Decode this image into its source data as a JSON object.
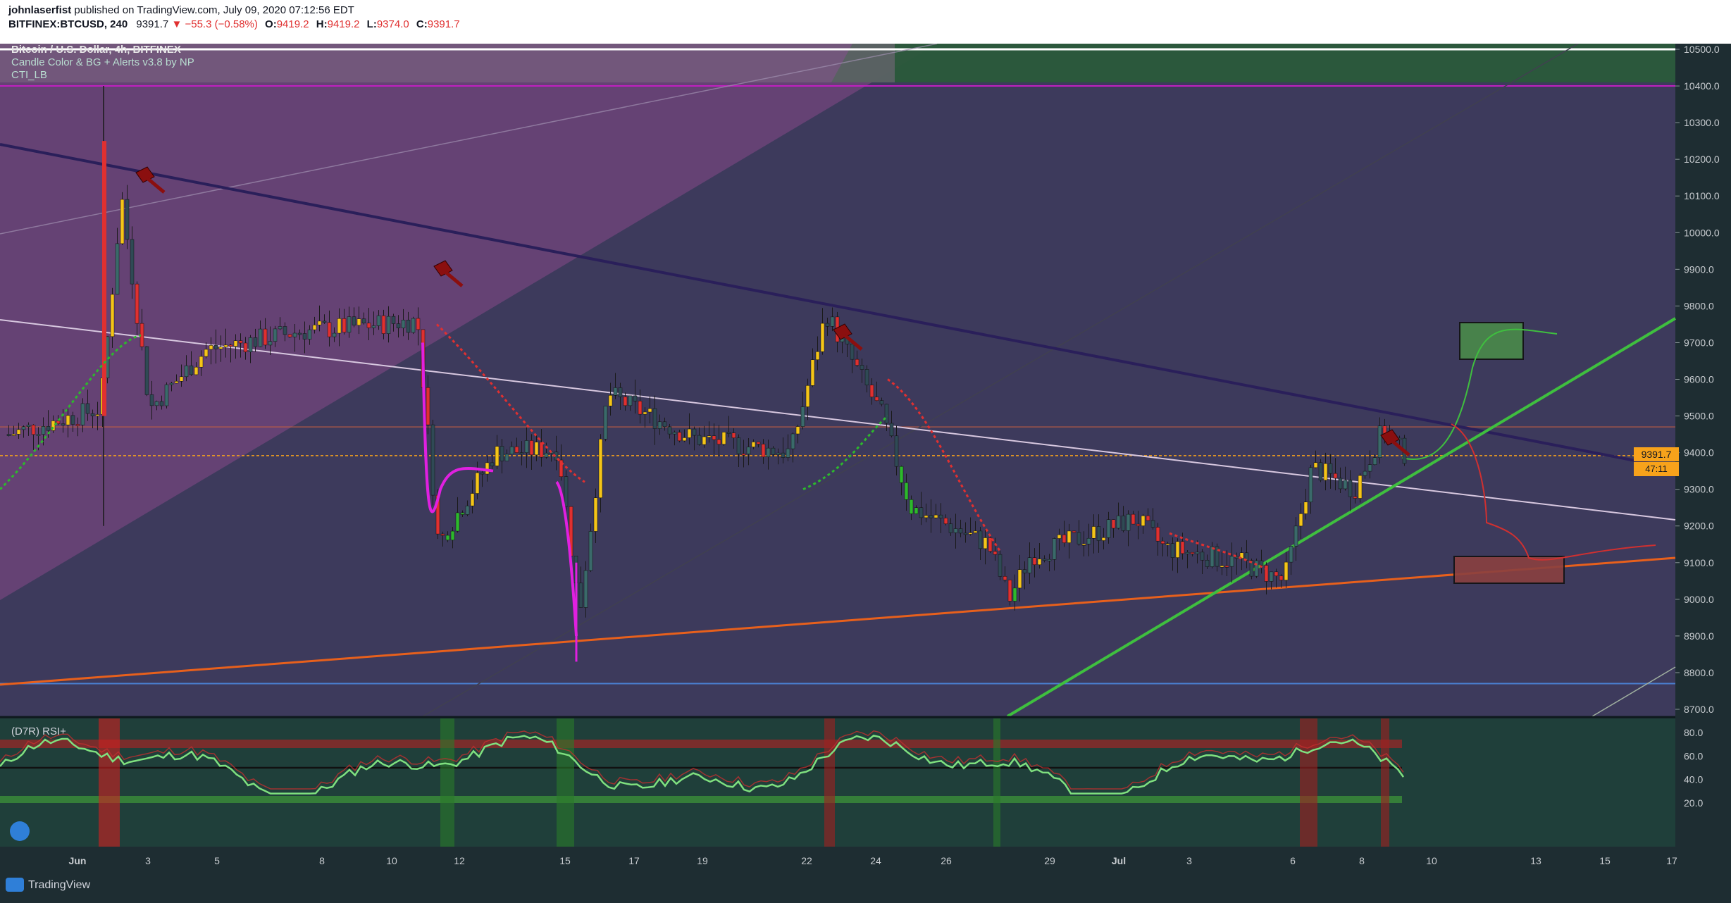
{
  "header": {
    "publisher": "johnlaserfist",
    "published_text": "published on TradingView.com, July 09, 2020 07:12:56 EDT",
    "symbol": "BITFINEX:BTCUSD, 240",
    "last": "9391.7",
    "change": "−55.3 (−0.58%)",
    "o_label": "O:",
    "o_val": "9419.2",
    "h_label": "H:",
    "h_val": "9419.2",
    "l_label": "L:",
    "l_val": "9374.0",
    "c_label": "C:",
    "c_val": "9391.7"
  },
  "legend": {
    "title": "Bitcoin / U.S. Dollar, 4h, BITFINEX",
    "indicator_1": "Candle Color & BG + Alerts v3.8 by NP",
    "indicator_2": "CTI_LB",
    "rsi_label": "(D7R) RSI+"
  },
  "price_axis": {
    "ticks": [
      "10500.0",
      "10400.0",
      "10300.0",
      "10200.0",
      "10100.0",
      "10000.0",
      "9900.0",
      "9800.0",
      "9700.0",
      "9600.0",
      "9500.0",
      "9400.0",
      "9300.0",
      "9200.0",
      "9100.0",
      "9000.0",
      "8900.0",
      "8800.0",
      "8700.0"
    ],
    "current_price": "9391.7",
    "countdown": "47:11"
  },
  "rsi_axis": {
    "ticks": [
      "80.0",
      "60.0",
      "40.0",
      "20.0"
    ]
  },
  "time_axis": {
    "labels": [
      "Jun",
      "3",
      "5",
      "8",
      "10",
      "12",
      "15",
      "17",
      "19",
      "22",
      "24",
      "26",
      "29",
      "Jul",
      "3",
      "6",
      "8",
      "10",
      "13",
      "15",
      "17"
    ]
  },
  "footer": {
    "brand": "TradingView"
  },
  "colors": {
    "bg": "#1e2d32",
    "purple_zone": "#6c4478",
    "green_zone": "#2a5a3a",
    "bull": "#f5c518",
    "bear": "#e03030",
    "green_candle": "#2db82d",
    "magenta": "#e020e0",
    "orange_line": "#e8601c",
    "green_trend": "#3fbf3f",
    "navy_trend": "#2a1f5a"
  }
}
